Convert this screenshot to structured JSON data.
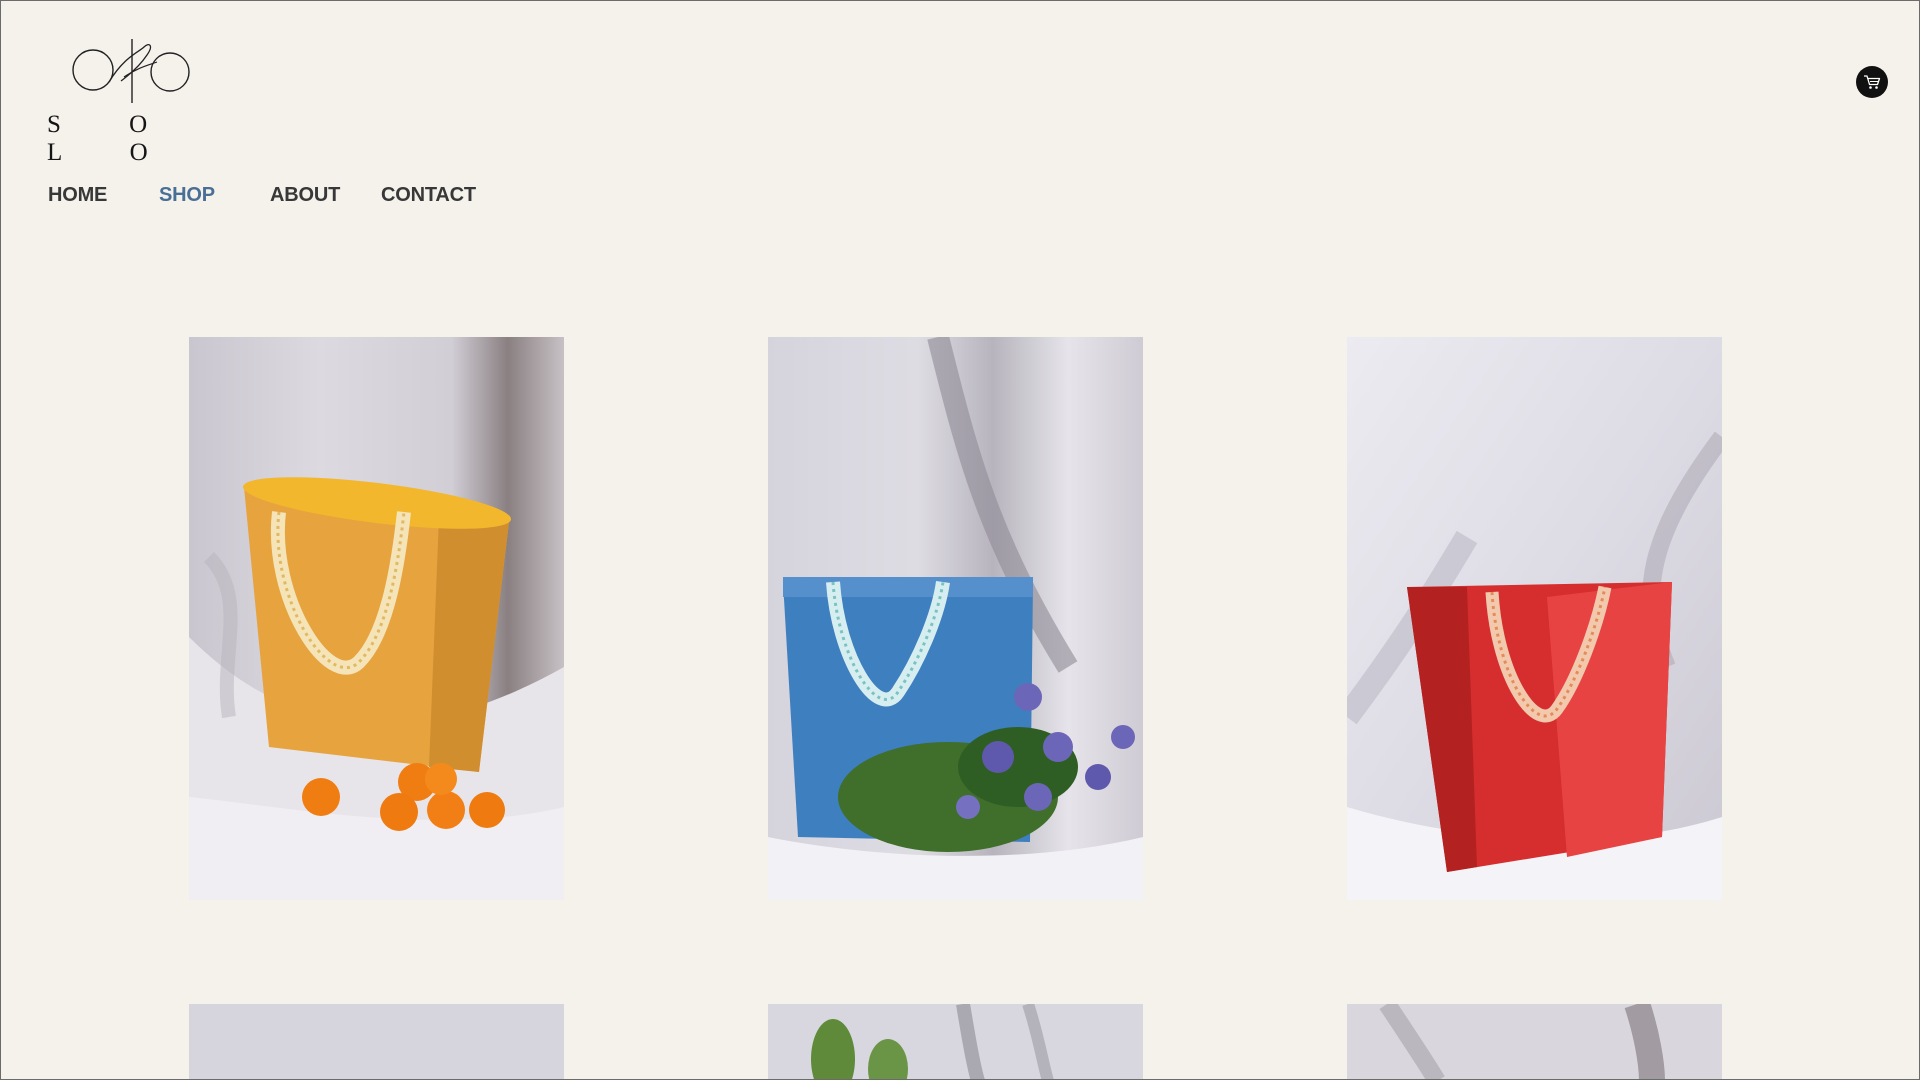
{
  "brand": {
    "name": "S O L O"
  },
  "nav": {
    "items": [
      {
        "label": "HOME",
        "active": false
      },
      {
        "label": "SHOP",
        "active": true
      },
      {
        "label": "ABOUT",
        "active": false
      },
      {
        "label": "CONTACT",
        "active": false
      }
    ]
  },
  "header": {
    "cart_icon": "cart-icon"
  },
  "products": [
    {
      "name": "orange-tote",
      "color": "#e6a03a",
      "props": "oranges"
    },
    {
      "name": "blue-tote",
      "color": "#3f7fbf",
      "props": "flowers"
    },
    {
      "name": "red-tote",
      "color": "#d62e2e",
      "props": "none"
    },
    {
      "name": "product-4",
      "color": "#d8d6dc"
    },
    {
      "name": "product-5",
      "color": "#d8d6dc"
    },
    {
      "name": "product-6",
      "color": "#d8d6dc"
    }
  ],
  "colors": {
    "background": "#f5f2ec",
    "nav_text": "#383838",
    "nav_active": "#4a6f96"
  }
}
